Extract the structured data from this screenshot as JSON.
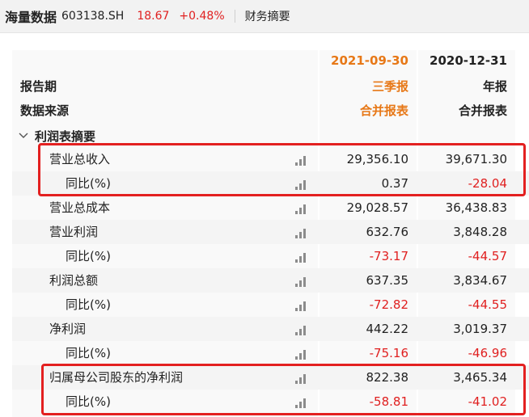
{
  "header": {
    "stock_name": "海量数据",
    "stock_code": "603138.SH",
    "price": "18.67",
    "change": "+0.48%",
    "tab": "财务摘要"
  },
  "table": {
    "row_label_period": "报告期",
    "row_label_source": "数据来源",
    "section_title": "利润表摘要",
    "columns": [
      {
        "date": "2021-09-30",
        "period_type": "三季报",
        "source": "合并报表"
      },
      {
        "date": "2020-12-31",
        "period_type": "年报",
        "source": "合并报表"
      }
    ],
    "rows": [
      {
        "label": "营业总收入",
        "indent": 1,
        "v1": "29,356.10",
        "v2": "39,671.30",
        "v1_neg": false,
        "v2_neg": false
      },
      {
        "label": "同比(%)",
        "indent": 2,
        "v1": "0.37",
        "v2": "-28.04",
        "v1_neg": false,
        "v2_neg": true
      },
      {
        "label": "营业总成本",
        "indent": 1,
        "v1": "29,028.57",
        "v2": "36,438.83",
        "v1_neg": false,
        "v2_neg": false
      },
      {
        "label": "营业利润",
        "indent": 1,
        "v1": "632.76",
        "v2": "3,848.28",
        "v1_neg": false,
        "v2_neg": false
      },
      {
        "label": "同比(%)",
        "indent": 2,
        "v1": "-73.17",
        "v2": "-44.57",
        "v1_neg": true,
        "v2_neg": true
      },
      {
        "label": "利润总额",
        "indent": 1,
        "v1": "637.35",
        "v2": "3,834.67",
        "v1_neg": false,
        "v2_neg": false
      },
      {
        "label": "同比(%)",
        "indent": 2,
        "v1": "-72.82",
        "v2": "-44.55",
        "v1_neg": true,
        "v2_neg": true
      },
      {
        "label": "净利润",
        "indent": 1,
        "v1": "442.22",
        "v2": "3,019.37",
        "v1_neg": false,
        "v2_neg": false
      },
      {
        "label": "同比(%)",
        "indent": 2,
        "v1": "-75.16",
        "v2": "-46.96",
        "v1_neg": true,
        "v2_neg": true
      },
      {
        "label": "归属母公司股东的净利润",
        "indent": 1,
        "v1": "822.38",
        "v2": "3,465.34",
        "v1_neg": false,
        "v2_neg": false
      },
      {
        "label": "同比(%)",
        "indent": 2,
        "v1": "-58.81",
        "v2": "-41.02",
        "v1_neg": true,
        "v2_neg": true
      }
    ]
  },
  "colors": {
    "accent_orange": "#e77817",
    "negative_red": "#e02020",
    "highlight_red": "#e32020"
  }
}
